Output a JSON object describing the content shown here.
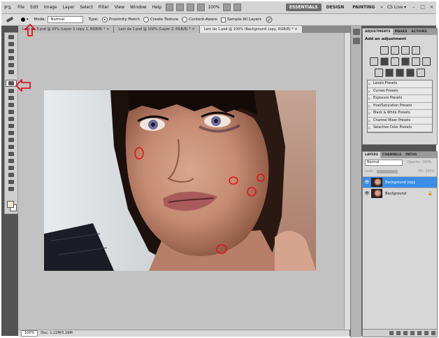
{
  "app": {
    "logo": "PS"
  },
  "menu": [
    "File",
    "Edit",
    "Image",
    "Layer",
    "Select",
    "Filter",
    "View",
    "Window",
    "Help"
  ],
  "menubar": {
    "zoom": "100%",
    "workspaces": [
      "ESSENTIALS",
      "DESIGN",
      "PAINTING"
    ],
    "more": "»",
    "cslive": "CS Live ▾",
    "win_min": "–",
    "win_max": "□",
    "win_close": "×"
  },
  "options": {
    "mode_label": "Mode:",
    "mode_value": "Normal",
    "type_label": "Type:",
    "type_options": [
      "Proximity Match",
      "Create Texture",
      "Content-Aware"
    ],
    "sample_all": "Sample All Layers"
  },
  "tabs": [
    {
      "label": "Lam da 3.psd @ 25% (Layer 1 copy 1, RGB/8) *",
      "close": "×"
    },
    {
      "label": "Lam da 2.psd @ 100% (Layer 2, RGB/8) *",
      "close": "×"
    },
    {
      "label": "Lam da 1.psd @ 100% (Background copy, RGB/8) *",
      "close": "×"
    }
  ],
  "status": {
    "zoom": "100%",
    "doc": "Doc: 1.22M/5.29M"
  },
  "adjustments": {
    "tabs": [
      "ADJUSTMENTS",
      "MASKS",
      "ACTIONS"
    ],
    "title": "Add an adjustment",
    "presets": [
      "Levels Presets",
      "Curves Presets",
      "Exposure Presets",
      "Hue/Saturation Presets",
      "Black & White Presets",
      "Channel Mixer Presets",
      "Selective Color Presets"
    ]
  },
  "layers": {
    "tabs": [
      "LAYERS",
      "CHANNELS",
      "PATHS"
    ],
    "blend": "Normal",
    "opacity_label": "Opacity:",
    "opacity": "100%",
    "lock_label": "Lock:",
    "fill_label": "Fill:",
    "fill": "100%",
    "items": [
      {
        "name": "Background copy",
        "selected": true
      },
      {
        "name": "Background",
        "selected": false
      }
    ]
  },
  "colors": {
    "selection": "#3b8de6",
    "annotation": "#e0141e"
  }
}
